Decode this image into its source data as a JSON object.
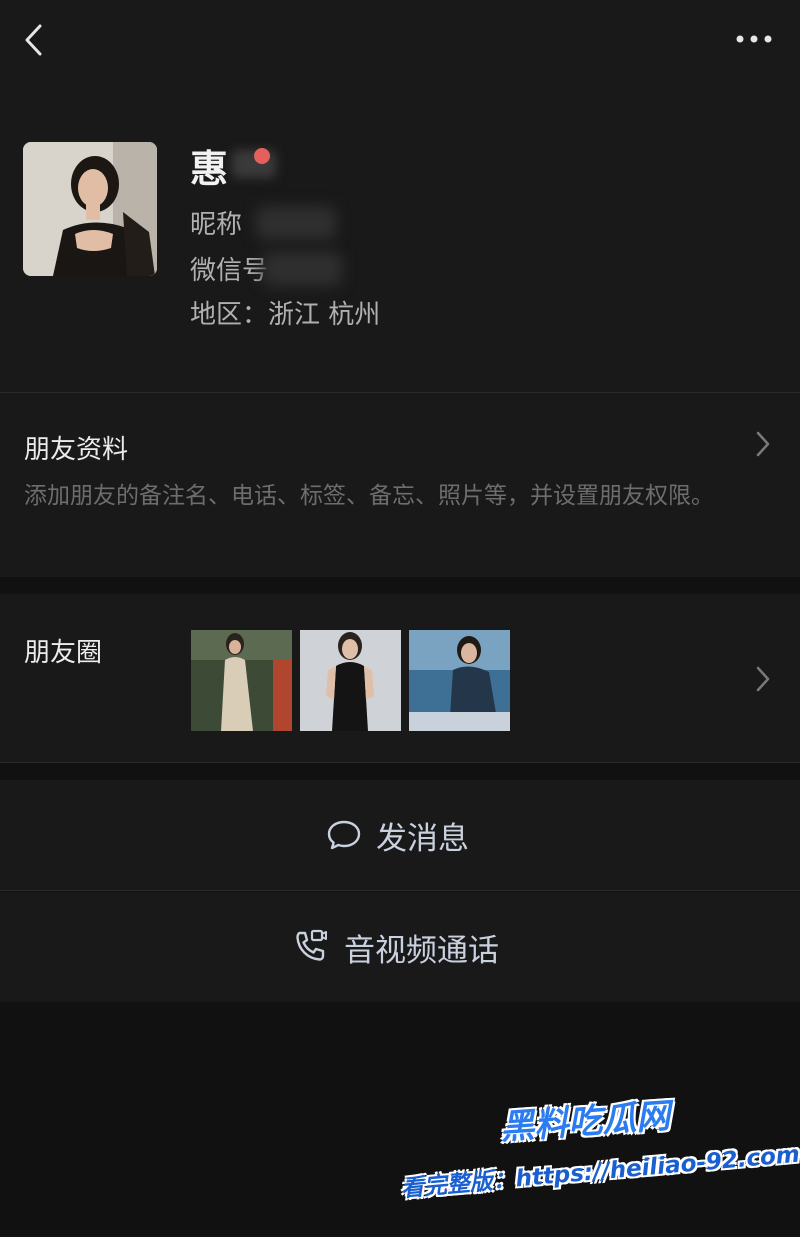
{
  "header": {
    "back_icon": "chevron-left-icon",
    "more_icon": "more-dots-icon"
  },
  "profile": {
    "name": "惠",
    "nickname_label": "昵称",
    "wechat_id_label": "微信号",
    "region": "地区：浙江 杭州"
  },
  "friend_info": {
    "title": "朋友资料",
    "description": "添加朋友的备注名、电话、标签、备忘、照片等，并设置朋友权限。"
  },
  "moments": {
    "title": "朋友圈"
  },
  "actions": {
    "message_label": "发消息",
    "call_label": "音视频通话"
  },
  "watermark": {
    "brand": "黑料吃瓜网",
    "line": "看完整版：https://heiliao-92.com"
  },
  "colors": {
    "background": "#111111",
    "panel": "#191919",
    "divider": "#2b2b2b",
    "action_text": "#c9d0de",
    "watermark_blue": "#1e74e8"
  }
}
